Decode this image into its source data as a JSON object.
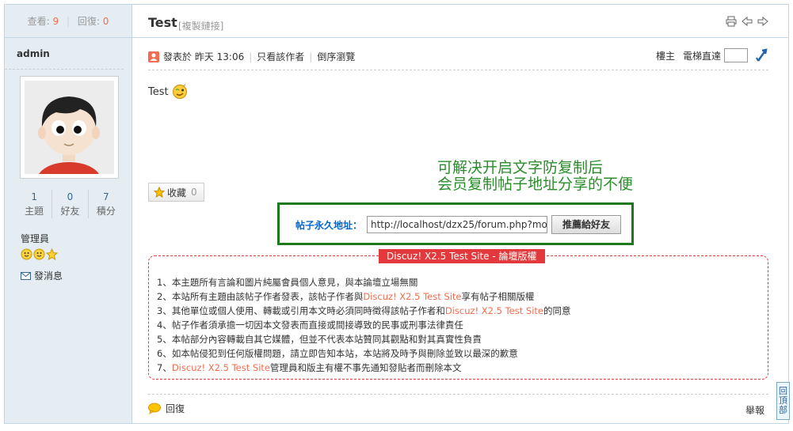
{
  "stats": {
    "views_label": "查看:",
    "views": "9",
    "replies_label": "回復:",
    "replies": "0"
  },
  "author": {
    "name": "admin",
    "counts": [
      {
        "value": "1",
        "label": "主題"
      },
      {
        "value": "0",
        "label": "好友"
      },
      {
        "value": "7",
        "label": "積分"
      }
    ],
    "role": "管理員",
    "send_pm": "發消息"
  },
  "post": {
    "title": "Test",
    "copy_link": "[複製鏈接]",
    "posted_on": "發表於 昨天 13:06",
    "only_author": "只看該作者",
    "reverse": "倒序瀏覽",
    "floor": "樓主",
    "jump_label": "電梯直達",
    "content": "Test",
    "favorite_label": "收藏",
    "favorite_count": "0"
  },
  "note": {
    "line1": "可解决开启文字防复制后",
    "line2": "会员复制帖子地址分享的不便"
  },
  "share": {
    "label": "帖子永久地址：",
    "url": "http://localhost/dzx25/forum.php?mod=",
    "button": "推薦給好友"
  },
  "copyright": {
    "legend": "Discuz! X2.5 Test Site - 論壇版權",
    "site": "Discuz! X2.5 Test Site",
    "items": [
      "1、本主題所有言論和圖片純屬會員個人意見，與本論壇立場無關",
      "2、本站所有主題由該帖子作者發表，該帖子作者與",
      "享有帖子相關版權",
      "3、其他單位或個人使用、轉載或引用本文時必須同時徵得該帖子作者和",
      "的同意",
      "4、帖子作者須承擔一切因本文發表而直接或間接導致的民事或刑事法律責任",
      "5、本帖部分內容轉載自其它媒體，但並不代表本站贊同其觀點和對其真實性負責",
      "6、如本帖侵犯到任何版權問題，請立即告知本站，本站將及時予與刪除並致以最深的歉意",
      "7、",
      "管理員和版主有權不事先通知發貼者而刪除本文"
    ]
  },
  "footer": {
    "reply": "回復",
    "report": "舉報"
  },
  "back_top": "回頂部",
  "colors": {
    "accent": "#f26c4f",
    "border": "#c2d5e3",
    "sidebar": "#e5edf2",
    "note": "#2b8c2b",
    "red": "#e4393c"
  }
}
